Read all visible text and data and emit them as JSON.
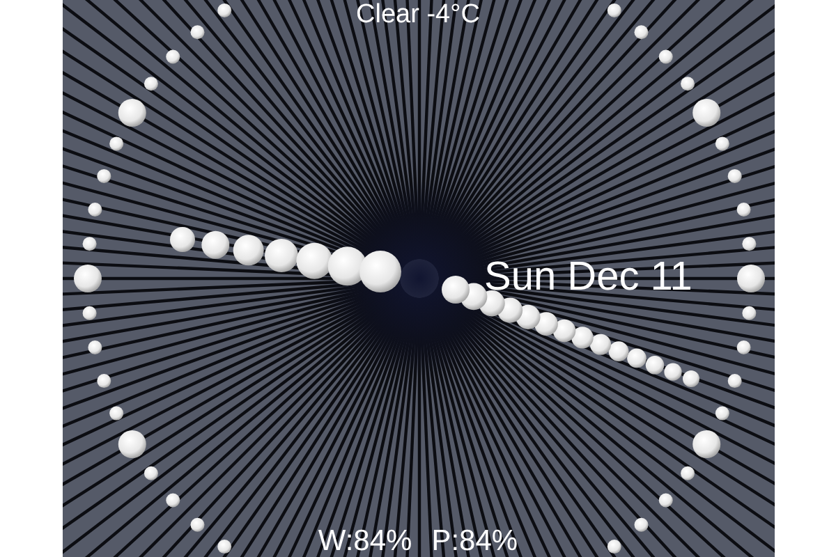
{
  "weather": {
    "text": "Clear -4°C"
  },
  "date": {
    "text": "Sun Dec 11"
  },
  "footer": {
    "watch_battery": "W:84%",
    "phone_battery": "P:84%"
  }
}
